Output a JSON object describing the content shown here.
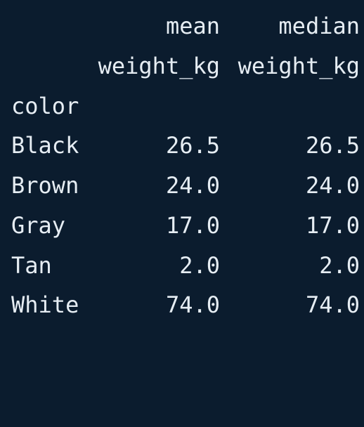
{
  "table": {
    "header_level1": [
      "mean",
      "median"
    ],
    "header_level2": [
      "weight_kg",
      "weight_kg"
    ],
    "index_name": "color",
    "rows": [
      {
        "label": "Black",
        "mean": "26.5",
        "median": "26.5"
      },
      {
        "label": "Brown",
        "mean": "24.0",
        "median": "24.0"
      },
      {
        "label": "Gray",
        "mean": "17.0",
        "median": "17.0"
      },
      {
        "label": "Tan",
        "mean": "2.0",
        "median": "2.0"
      },
      {
        "label": "White",
        "mean": "74.0",
        "median": "74.0"
      }
    ]
  },
  "colors": {
    "background": "#0b1c2e",
    "text": "#e6edf3"
  }
}
